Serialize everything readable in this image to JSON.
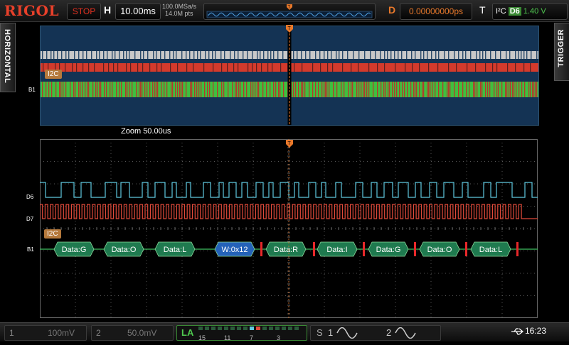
{
  "topbar": {
    "logo": "RIGOL",
    "run_state": "STOP",
    "horizontal_label": "H",
    "timebase": "10.00ms",
    "sample_rate": "100.0MSa/s",
    "memory_depth": "14.0M pts",
    "delay_label": "D",
    "delay_value": "0.00000000ps",
    "trigger_label": "T",
    "trigger_type": "I²C",
    "trigger_source": "D6",
    "trigger_level": "1.40 V"
  },
  "side_tabs": {
    "left": "HORIZONTAL",
    "right": "TRIGGER"
  },
  "overview": {
    "bus_tag": "I2C",
    "bus_label": "B1"
  },
  "zoom": {
    "label": "Zoom",
    "value": "50.00us"
  },
  "main": {
    "bus_tag": "I2C",
    "bus_label": "B1",
    "channels": [
      "D6",
      "D7"
    ],
    "packets": [
      {
        "text": "Data:G",
        "kind": "data"
      },
      {
        "text": "Data:O",
        "kind": "data"
      },
      {
        "text": "Data:L",
        "kind": "data"
      },
      {
        "text": "W:0x12",
        "kind": "address"
      },
      {
        "text": "Data:R",
        "kind": "data"
      },
      {
        "text": "Data:I",
        "kind": "data"
      },
      {
        "text": "Data:G",
        "kind": "data"
      },
      {
        "text": "Data:O",
        "kind": "data"
      },
      {
        "text": "Data:L",
        "kind": "data"
      }
    ]
  },
  "bottombar": {
    "ch1_num": "1",
    "ch1_scale": "100mV",
    "ch2_num": "2",
    "ch2_scale": "50.0mV",
    "la_label": "LA",
    "la_numbers": [
      "15",
      "11",
      "7",
      "3"
    ],
    "s_label": "S",
    "s1_num": "1",
    "s2_num": "2",
    "clock": "16:23"
  },
  "colors": {
    "d6": "#5fc9e0",
    "d7": "#e04a3a",
    "bus": "#3fbf5f",
    "data_packet": "#1f7a4f",
    "address_packet": "#2462b8",
    "trigger": "#e8782a"
  }
}
